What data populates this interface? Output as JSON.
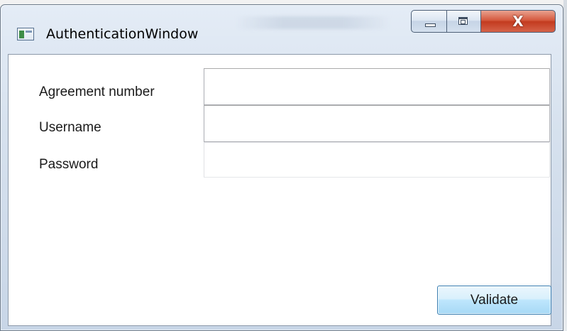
{
  "window": {
    "title": "AuthenticationWindow",
    "icon": "app-window-icon",
    "caption_buttons": {
      "minimize_icon": "minimize-icon",
      "maximize_icon": "maximize-icon",
      "close_label": "X"
    }
  },
  "form": {
    "fields": [
      {
        "label": "Agreement number",
        "value": "",
        "placeholder": ""
      },
      {
        "label": "Username",
        "value": "",
        "placeholder": ""
      },
      {
        "label": "Password",
        "value": "",
        "placeholder": ""
      }
    ],
    "validate_label": "Validate"
  },
  "colors": {
    "close_button": "#c33b1f",
    "validate_button_border": "#3c7fb1",
    "validate_button_fill": "#bee6fd"
  }
}
